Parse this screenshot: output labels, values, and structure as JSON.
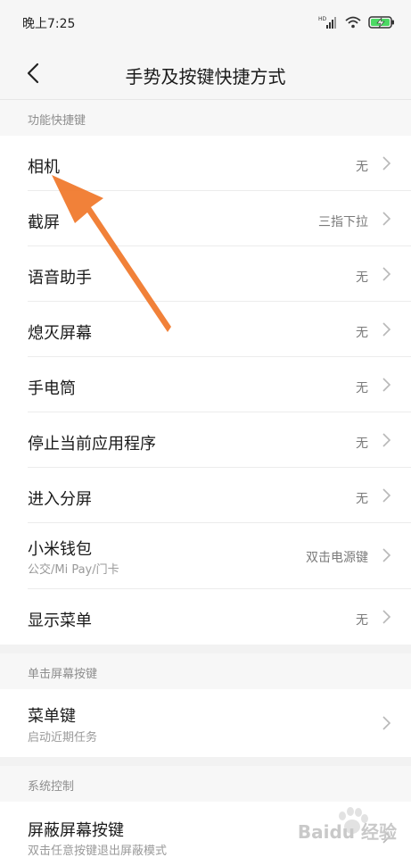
{
  "status": {
    "time": "晚上7:25",
    "network_label": "HD"
  },
  "header": {
    "title": "手势及按键快捷方式"
  },
  "sections": [
    {
      "title": "功能快捷键",
      "items": [
        {
          "label": "相机",
          "value": "无"
        },
        {
          "label": "截屏",
          "value": "三指下拉"
        },
        {
          "label": "语音助手",
          "value": "无"
        },
        {
          "label": "熄灭屏幕",
          "value": "无"
        },
        {
          "label": "手电筒",
          "value": "无"
        },
        {
          "label": "停止当前应用程序",
          "value": "无"
        },
        {
          "label": "进入分屏",
          "value": "无"
        },
        {
          "label": "小米钱包",
          "sub": "公交/Mi Pay/门卡",
          "value": "双击电源键"
        },
        {
          "label": "显示菜单",
          "value": "无"
        }
      ]
    },
    {
      "title": "单击屏幕按键",
      "items": [
        {
          "label": "菜单键",
          "sub": "启动近期任务"
        }
      ]
    },
    {
      "title": "系统控制",
      "items": [
        {
          "label": "屏蔽屏幕按键",
          "sub": "双击任意按键退出屏蔽模式"
        }
      ]
    }
  ],
  "watermark": {
    "text": "Baidu 经验"
  },
  "colors": {
    "arrow": "#f07a2e",
    "chevron": "#b8b8b8",
    "battery": "#4cd964"
  }
}
